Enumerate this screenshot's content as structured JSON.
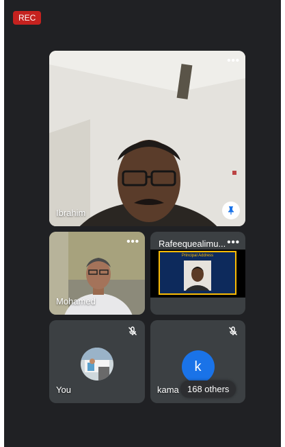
{
  "recording": {
    "label": "REC"
  },
  "tiles": {
    "main": {
      "name": "Ibrahim"
    },
    "tile2": {
      "name": "Mohamed"
    },
    "tile3": {
      "name": "Rafeequealimu...",
      "slide_title": "Principal Address"
    },
    "you": {
      "name": "You"
    },
    "tile5": {
      "name": "kama",
      "avatar_letter": "k"
    }
  },
  "others_chip": {
    "label": "168 others"
  },
  "colors": {
    "background": "#202124",
    "tile": "#3c4043",
    "rec": "#c5221f",
    "avatar": "#1a73e8"
  },
  "icons": {
    "more": "more-icon",
    "pin": "pin-icon",
    "mic_off": "mic-off-icon"
  }
}
